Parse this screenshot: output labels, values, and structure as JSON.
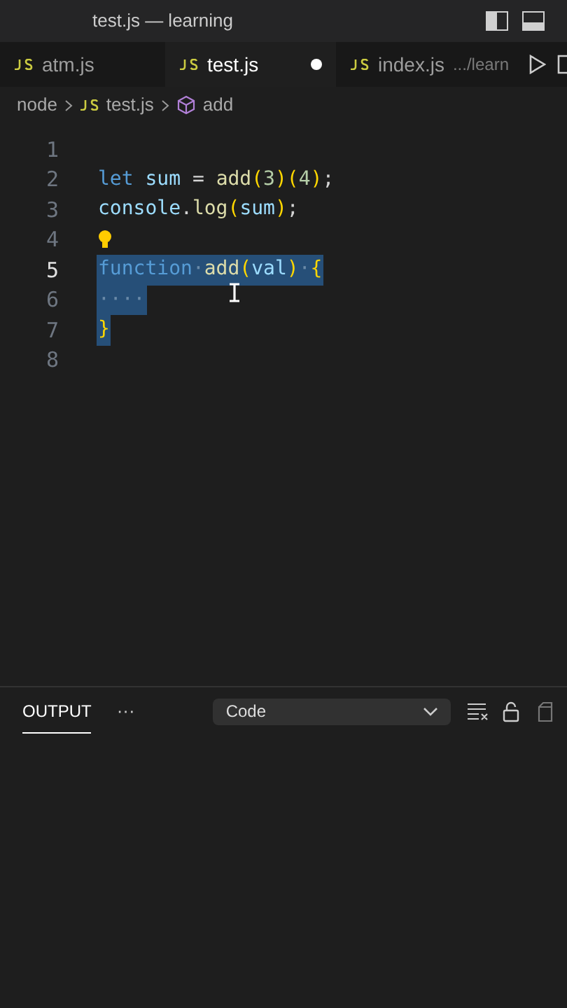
{
  "window": {
    "title": "test.js — learning"
  },
  "tabs": [
    {
      "label": "atm.js",
      "selected": false,
      "modified": false
    },
    {
      "label": "test.js",
      "selected": true,
      "modified": true
    },
    {
      "label": "index.js",
      "path": ".../learn",
      "selected": false,
      "modified": false
    }
  ],
  "breadcrumb": [
    {
      "label": "node",
      "kind": "folder"
    },
    {
      "label": "test.js",
      "kind": "file"
    },
    {
      "label": "add",
      "kind": "symbol"
    }
  ],
  "editor": {
    "lines": [
      {
        "number": "1",
        "active": false,
        "selected": false,
        "lightbulb": false
      },
      {
        "number": "2",
        "active": false,
        "selected": false,
        "lightbulb": false,
        "tokens": [
          {
            "text": "let",
            "kind": "keyword"
          },
          {
            "text": " sum",
            "kind": "variable"
          },
          {
            "text": " = ",
            "kind": "plain"
          },
          {
            "text": "add",
            "kind": "function"
          },
          {
            "text": "(",
            "kind": "bracket"
          },
          {
            "text": "3",
            "kind": "number"
          },
          {
            "text": ")(",
            "kind": "bracket"
          },
          {
            "text": "4",
            "kind": "number"
          },
          {
            "text": ")",
            "kind": "bracket"
          },
          {
            "text": ";",
            "kind": "plain"
          }
        ]
      },
      {
        "number": "3",
        "active": false,
        "selected": false,
        "lightbulb": false,
        "tokens": [
          {
            "text": "console",
            "kind": "variable"
          },
          {
            "text": ".",
            "kind": "plain"
          },
          {
            "text": "log",
            "kind": "function"
          },
          {
            "text": "(",
            "kind": "bracket"
          },
          {
            "text": "sum",
            "kind": "variable"
          },
          {
            "text": ")",
            "kind": "bracket"
          },
          {
            "text": ";",
            "kind": "plain"
          }
        ]
      },
      {
        "number": "4",
        "active": false,
        "selected": false,
        "lightbulb": true
      },
      {
        "number": "5",
        "active": true,
        "selected": true,
        "lightbulb": false,
        "tokens": [
          {
            "text": "function",
            "kind": "keyword"
          },
          {
            "text": "·",
            "kind": "whitespace"
          },
          {
            "text": "add",
            "kind": "function"
          },
          {
            "text": "(",
            "kind": "bracket"
          },
          {
            "text": "val",
            "kind": "variable"
          },
          {
            "text": ")",
            "kind": "bracket"
          },
          {
            "text": "·",
            "kind": "whitespace"
          },
          {
            "text": "{",
            "kind": "bracket"
          }
        ]
      },
      {
        "number": "6",
        "active": false,
        "selected": true,
        "lightbulb": false,
        "tokens": [
          {
            "text": "····",
            "kind": "whitespace"
          }
        ]
      },
      {
        "number": "7",
        "active": false,
        "selected": true,
        "lightbulb": false,
        "tokens": [
          {
            "text": "}",
            "kind": "bracket"
          }
        ]
      },
      {
        "number": "8",
        "active": false,
        "selected": false,
        "lightbulb": false
      }
    ]
  },
  "panel": {
    "tabs": [
      {
        "label": "OUTPUT",
        "selected": true
      }
    ],
    "more": "···",
    "channel": "Code"
  }
}
